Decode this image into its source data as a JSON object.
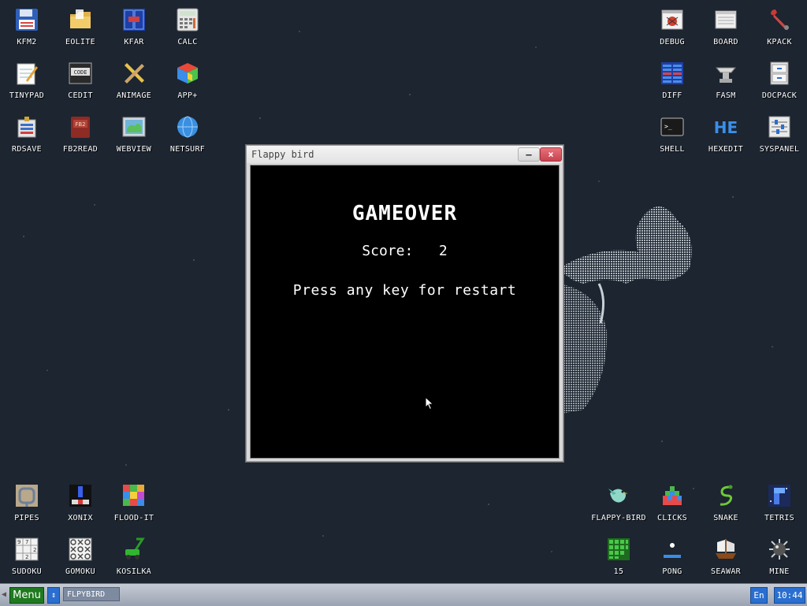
{
  "desktop": {
    "icons_top_left": [
      {
        "label": "KFM2",
        "icon": "floppy-disk-icon"
      },
      {
        "label": "EOLITE",
        "icon": "folder-icon"
      },
      {
        "label": "KFAR",
        "icon": "file-manager-icon"
      },
      {
        "label": "CALC",
        "icon": "calculator-icon"
      },
      {
        "label": "TINYPAD",
        "icon": "notepad-icon"
      },
      {
        "label": "CEDIT",
        "icon": "code-editor-icon"
      },
      {
        "label": "ANIMAGE",
        "icon": "pencil-ruler-icon"
      },
      {
        "label": "APP+",
        "icon": "rubiks-cube-icon"
      },
      {
        "label": "RDSAVE",
        "icon": "ramdisk-save-icon"
      },
      {
        "label": "FB2READ",
        "icon": "book-icon"
      },
      {
        "label": "WEBVIEW",
        "icon": "web-map-icon"
      },
      {
        "label": "NETSURF",
        "icon": "globe-icon"
      }
    ],
    "icons_top_right": [
      {
        "label": "DEBUG",
        "icon": "bug-icon"
      },
      {
        "label": "BOARD",
        "icon": "clipboard-board-icon"
      },
      {
        "label": "KPACK",
        "icon": "wrench-icon"
      },
      {
        "label": "DIFF",
        "icon": "diff-icon"
      },
      {
        "label": "FASM",
        "icon": "anvil-icon"
      },
      {
        "label": "DOCPACK",
        "icon": "cabinet-icon"
      },
      {
        "label": "SHELL",
        "icon": "terminal-icon"
      },
      {
        "label": "HEXEDIT",
        "icon": "hex-editor-icon"
      },
      {
        "label": "SYSPANEL",
        "icon": "sliders-icon"
      }
    ],
    "icons_bottom_left": [
      {
        "label": "PIPES",
        "icon": "pipes-icon"
      },
      {
        "label": "XONIX",
        "icon": "xonix-icon"
      },
      {
        "label": "FLOOD-IT",
        "icon": "color-grid-icon"
      },
      {
        "label": "SUDOKU",
        "icon": "sudoku-icon"
      },
      {
        "label": "GOMOKU",
        "icon": "gomoku-icon"
      },
      {
        "label": "KOSILKA",
        "icon": "lawnmower-icon"
      }
    ],
    "icons_bottom_right": [
      {
        "label": "FLAPPY-BIRD",
        "icon": "bird-icon"
      },
      {
        "label": "CLICKS",
        "icon": "clicks-blocks-icon"
      },
      {
        "label": "SNAKE",
        "icon": "snake-icon"
      },
      {
        "label": "TETRIS",
        "icon": "tetris-icon"
      },
      {
        "label": "15",
        "icon": "fifteen-puzzle-icon"
      },
      {
        "label": "PONG",
        "icon": "pong-icon"
      },
      {
        "label": "SEAWAR",
        "icon": "ship-icon"
      },
      {
        "label": "MINE",
        "icon": "mine-icon"
      }
    ]
  },
  "window": {
    "title": "Flappy bird",
    "minimize_label": "–",
    "close_label": "×",
    "game": {
      "heading": "GAMEOVER",
      "score_label": "Score:",
      "score_value": "2",
      "restart_text": "Press any key for restart"
    }
  },
  "taskbar": {
    "menu_label": "Menu",
    "switch_label": "↕",
    "task_item": "FLPYBIRD",
    "lang": "En",
    "clock": "10:44"
  },
  "colors": {
    "desktop_bg": "#1c2530",
    "menu_green": "#1f7a1f",
    "accent_blue": "#2a6fd0",
    "close_red": "#c7434f"
  }
}
